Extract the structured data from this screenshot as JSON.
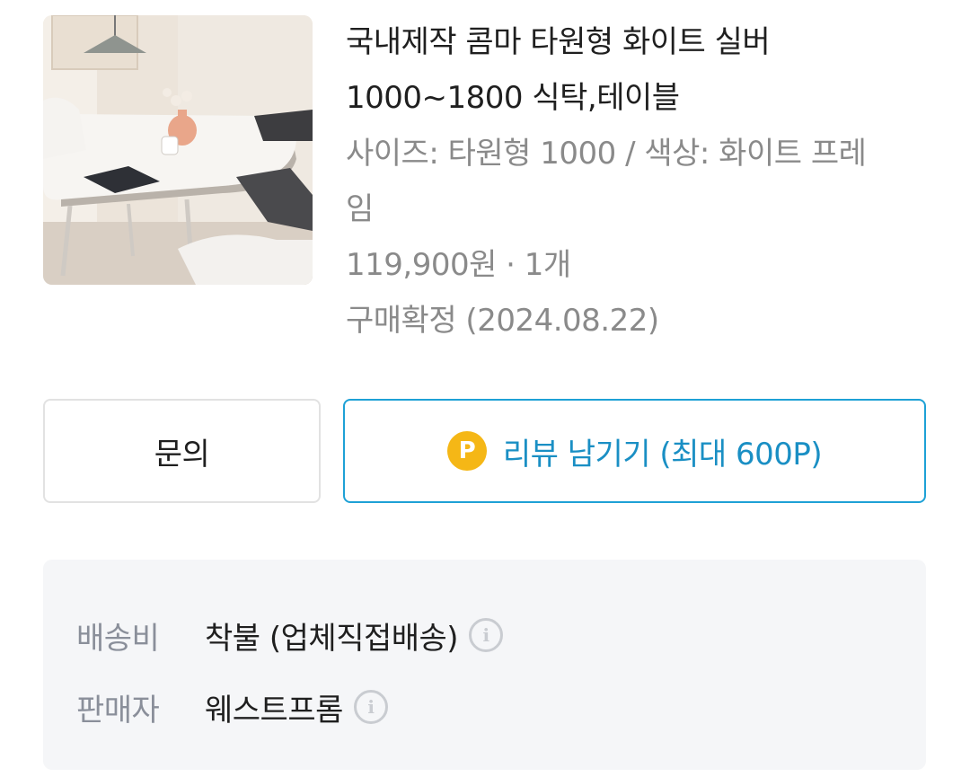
{
  "product": {
    "image_alt": "oval white dining table with chairs",
    "title_line1": "국내제작 콤마 타원형 화이트 실버",
    "title_line2": "1000~1800 식탁,테이블",
    "option_line1": "사이즈: 타원형 1000 / 색상: 화이트 프레",
    "option_line2": "임",
    "price_qty": "119,900원 · 1개",
    "status": "구매확정 (2024.08.22)"
  },
  "actions": {
    "inquiry_label": "문의",
    "review_icon_text": "P",
    "review_label": "리뷰 남기기 (최대 600P)"
  },
  "shipping": {
    "rows": [
      {
        "label": "배송비",
        "value": "착불 (업체직접배송)",
        "icon": "info-icon"
      },
      {
        "label": "판매자",
        "value": "웨스트프롬",
        "icon": "info-icon"
      }
    ]
  },
  "colors": {
    "accent": "#1ea1d6",
    "point": "#f5b716",
    "info_bg": "#f5f6f8"
  }
}
